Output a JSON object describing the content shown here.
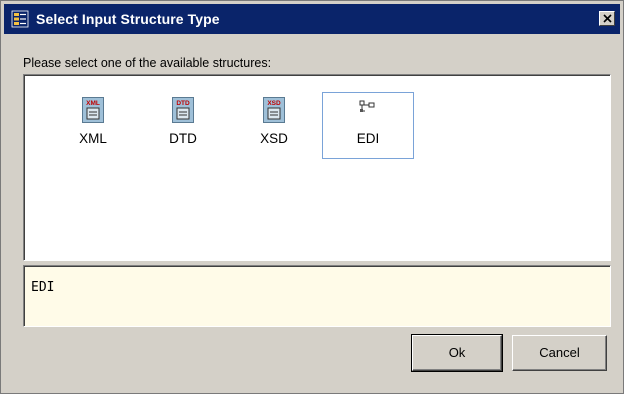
{
  "dialog": {
    "title": "Select Input Structure Type",
    "icon": "dialog-structure-icon",
    "close_icon": "close-icon"
  },
  "prompt": "Please select one of the available structures:",
  "structures": [
    {
      "label": "XML",
      "icon_text": "XML",
      "icon": "xml-document-icon"
    },
    {
      "label": "DTD",
      "icon_text": "DTD",
      "icon": "dtd-document-icon"
    },
    {
      "label": "XSD",
      "icon_text": "XSD",
      "icon": "xsd-document-icon"
    },
    {
      "label": "EDI",
      "icon": "edi-tree-icon",
      "selected": true
    }
  ],
  "description": "EDI",
  "buttons": {
    "ok": "Ok",
    "cancel": "Cancel"
  },
  "colors": {
    "titlebar": "#0a246a",
    "description_background": "#fffbe8",
    "selection_border": "#7aa3d8"
  }
}
